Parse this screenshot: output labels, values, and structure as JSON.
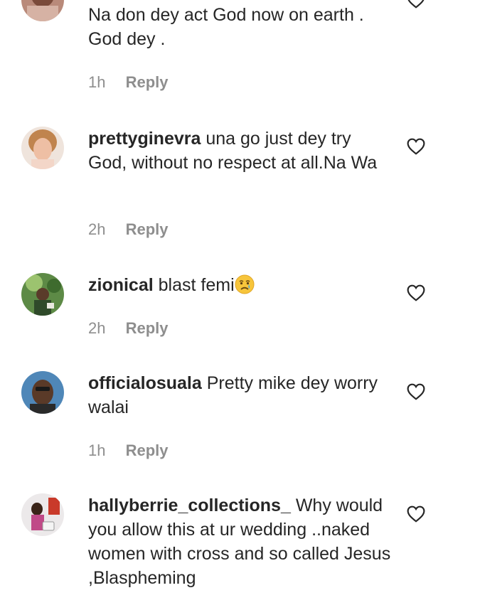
{
  "comments": [
    {
      "username": "",
      "text": "Na don dey act God now on earth .\nGod dey .",
      "time": "1h",
      "reply_label": "Reply"
    },
    {
      "username": "prettyginevra",
      "text": "una go just dey try God, without no respect at all.Na Wa",
      "time": "2h",
      "reply_label": "Reply"
    },
    {
      "username": "zionical",
      "text": "blast femi",
      "emoji": "😢",
      "time": "2h",
      "reply_label": "Reply"
    },
    {
      "username": "officialosuala",
      "text": "Pretty mike dey worry walai",
      "time": "1h",
      "reply_label": "Reply"
    },
    {
      "username": "hallyberrie_collections_",
      "text": "Why would you allow this at ur wedding ..naked women with cross and so called Jesus ,Blaspheming",
      "time": "",
      "reply_label": ""
    }
  ],
  "icons": {
    "like": "heart-outline-icon",
    "emoji": "crying-face"
  },
  "colors": {
    "text": "#262626",
    "meta": "#8e8e8e",
    "background": "#ffffff"
  }
}
